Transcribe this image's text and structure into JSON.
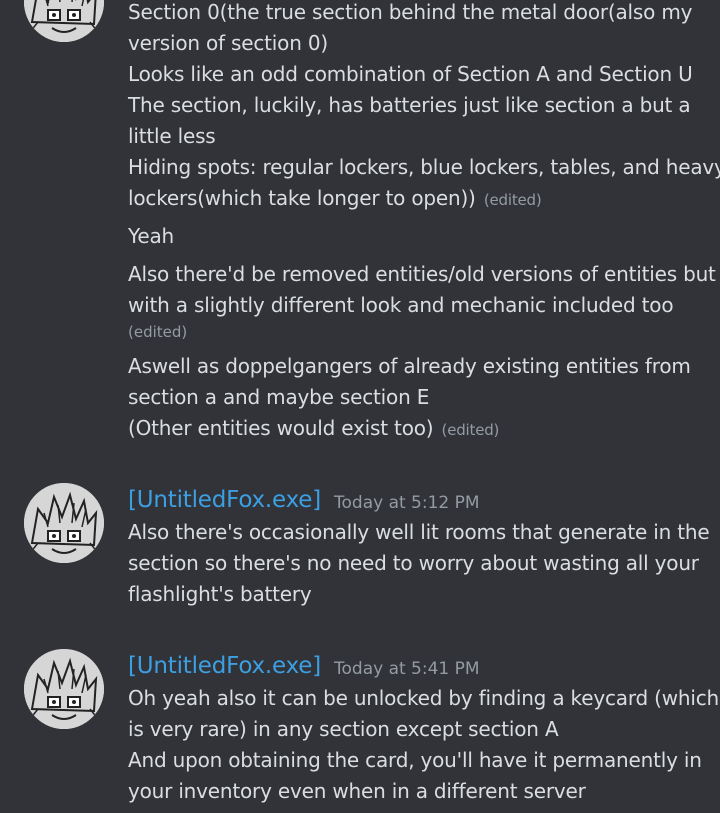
{
  "messages": {
    "m1": {
      "lines": [
        "Section 0(the true section behind the metal door(also my",
        "version of section 0)",
        "Looks like an odd combination of Section A and Section U",
        "The section, luckily, has batteries just like section a but a",
        "little less",
        "Hiding spots: regular lockers, blue lockers, tables, and heavy",
        "lockers(which take longer to open))"
      ],
      "edited": "(edited)"
    },
    "m2": {
      "text": "Yeah"
    },
    "m3": {
      "lines": [
        "Also there'd be removed entities/old versions of entities but",
        "with a slightly different look and mechanic included too"
      ],
      "edited": "(edited)"
    },
    "m4": {
      "lines": [
        "Aswell as doppelgangers of already existing entities from",
        "section a and maybe section E",
        "(Other entities would exist too)"
      ],
      "edited": "(edited)"
    },
    "group2": {
      "username": "[UntitledFox.exe]",
      "timestamp": "Today at 5:12 PM",
      "lines": [
        "Also there's occasionally well lit rooms that generate in the",
        "section so there's no need to worry about wasting all your",
        "flashlight's battery"
      ]
    },
    "group3": {
      "username": "[UntitledFox.exe]",
      "timestamp": "Today at 5:41 PM",
      "lines": [
        "Oh yeah also it can be unlocked by finding a keycard (which",
        "is very rare) in any section except section A",
        "And upon obtaining the card, you'll have it permanently in",
        "your inventory even when in a different server"
      ]
    }
  },
  "colors": {
    "background": "#313338",
    "text": "#dbdee1",
    "username": "#3c9fe2",
    "muted": "#949ba4"
  },
  "icons": {
    "avatar": "fox-drawing-avatar"
  }
}
